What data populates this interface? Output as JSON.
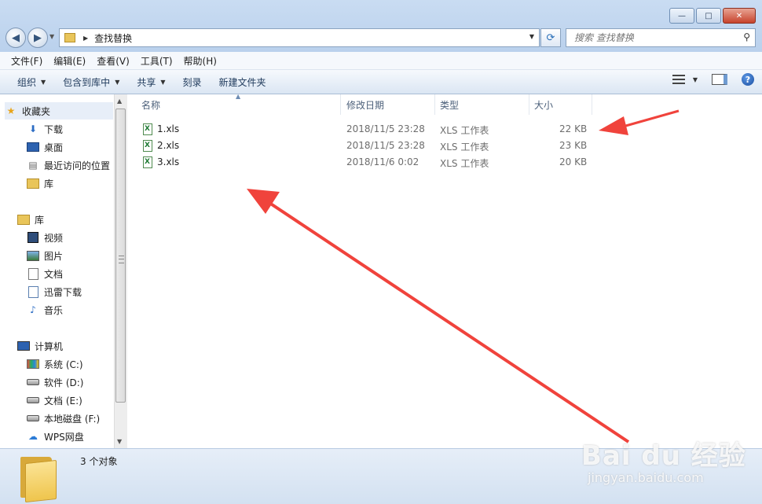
{
  "window": {
    "controls": {
      "minimize": "—",
      "maximize": "□",
      "close": "✕"
    }
  },
  "address": {
    "path": "查找替换",
    "search_placeholder": "搜索 查找替换"
  },
  "menu": [
    "文件(F)",
    "编辑(E)",
    "查看(V)",
    "工具(T)",
    "帮助(H)"
  ],
  "toolbar": {
    "organize": "组织",
    "include_in_library": "包含到库中",
    "share": "共享",
    "burn": "刻录",
    "new_folder": "新建文件夹"
  },
  "nav": {
    "favorites": {
      "label": "收藏夹",
      "items": [
        "下载",
        "桌面",
        "最近访问的位置",
        "库"
      ]
    },
    "libraries": {
      "label": "库",
      "items": [
        "视频",
        "图片",
        "文档",
        "迅雷下载",
        "音乐"
      ]
    },
    "computer": {
      "label": "计算机",
      "items": [
        "系统 (C:)",
        "软件 (D:)",
        "文档 (E:)",
        "本地磁盘 (F:)",
        "WPS网盘"
      ]
    }
  },
  "columns": {
    "name": "名称",
    "modified": "修改日期",
    "type": "类型",
    "size": "大小"
  },
  "files": [
    {
      "name": "1.xls",
      "modified": "2018/11/5 23:28",
      "type": "XLS 工作表",
      "size": "22 KB"
    },
    {
      "name": "2.xls",
      "modified": "2018/11/5 23:28",
      "type": "XLS 工作表",
      "size": "23 KB"
    },
    {
      "name": "3.xls",
      "modified": "2018/11/6 0:02",
      "type": "XLS 工作表",
      "size": "20 KB"
    }
  ],
  "status": {
    "count_text": "3 个对象"
  },
  "watermark": {
    "brand": "Bai du 经验",
    "url": "jingyan.baidu.com"
  },
  "colors": {
    "arrow": "#f0433c",
    "selection": "#e7eef8"
  }
}
